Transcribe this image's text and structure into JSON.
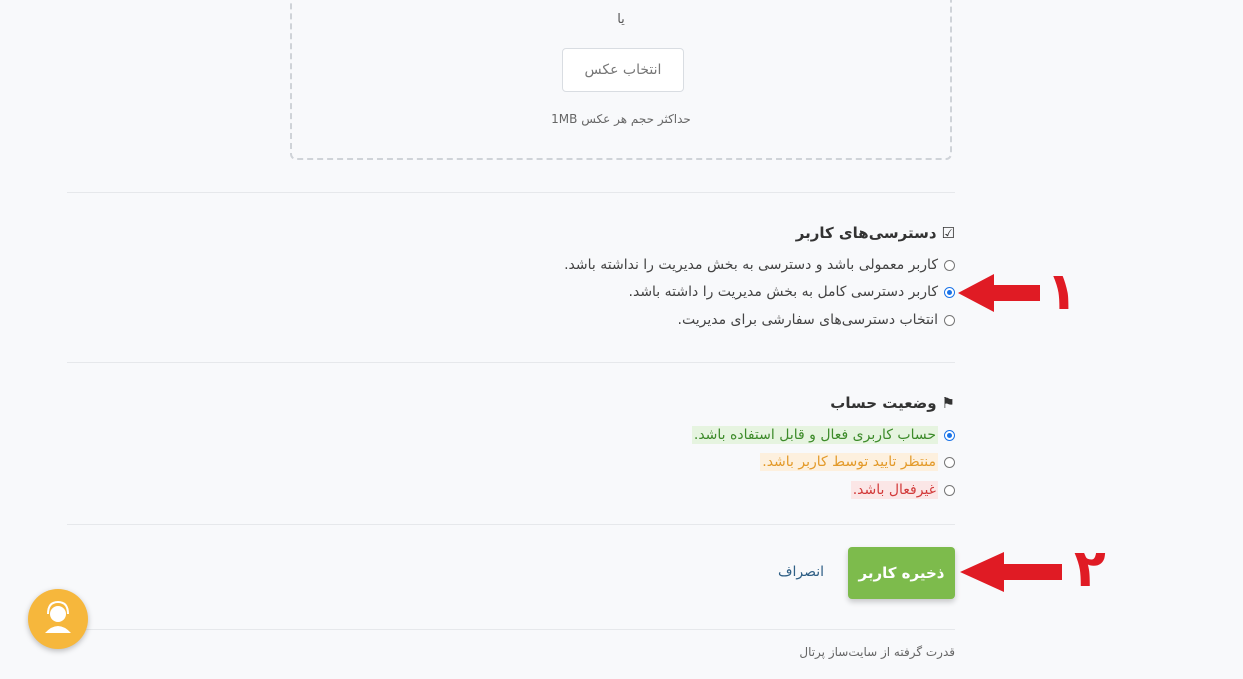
{
  "upload": {
    "or_text": "یا",
    "button_label": "انتخاب عکس",
    "note": "حداکثر حجم هر عکس 1MB"
  },
  "permissions": {
    "title": "دسترسی‌های کاربر",
    "options": [
      {
        "label": "کاربر معمولی باشد و دسترسی به بخش مدیریت را نداشته باشد.",
        "checked": false
      },
      {
        "label": "کاربر دسترسی کامل به بخش مدیریت را داشته باشد.",
        "checked": true
      },
      {
        "label": "انتخاب دسترسی‌های سفارشی برای مدیریت.",
        "checked": false
      }
    ]
  },
  "account_status": {
    "title": "وضعیت حساب",
    "options": [
      {
        "label": "حساب کاربری فعال و قابل استفاده باشد.",
        "checked": true,
        "color": "#3d8b2a"
      },
      {
        "label": "منتظر تایید توسط کاربر باشد.",
        "checked": false,
        "color": "#e39a2a"
      },
      {
        "label": "غیرفعال باشد.",
        "checked": false,
        "color": "#d23b3b"
      }
    ]
  },
  "actions": {
    "save_label": "ذخیره کاربر",
    "cancel_label": "انصراف"
  },
  "footer": {
    "powered_by": "قدرت گرفته از سایت‌ساز پرتال"
  },
  "annotations": {
    "one": "۱",
    "two": "۲"
  },
  "colors": {
    "save_button": "#7dbb4c",
    "annotation_red": "#e01b24",
    "radio_blue": "#1a73e8",
    "support_button": "#f6b73c"
  }
}
